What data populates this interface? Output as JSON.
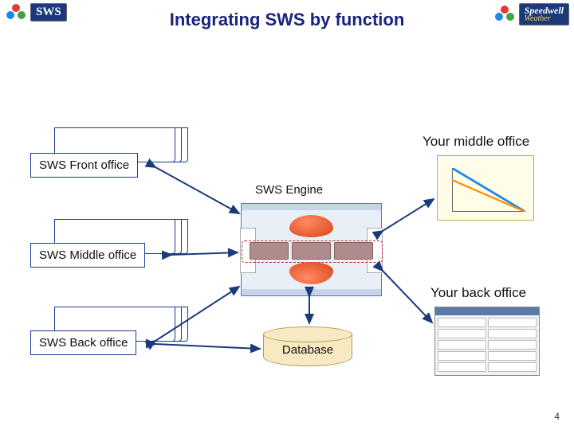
{
  "title": "Integrating SWS by function",
  "logo": {
    "left_text": "SWS",
    "right_line1": "Speedwell",
    "right_line2": "Weather"
  },
  "left_blocks": {
    "front": "SWS Front office",
    "middle": "SWS Middle office",
    "back": "SWS Back office"
  },
  "center": {
    "engine_label": "SWS Engine",
    "database_label": "Database"
  },
  "right_labels": {
    "middle": "Your middle office",
    "back": "Your back office"
  },
  "page_number": "4"
}
